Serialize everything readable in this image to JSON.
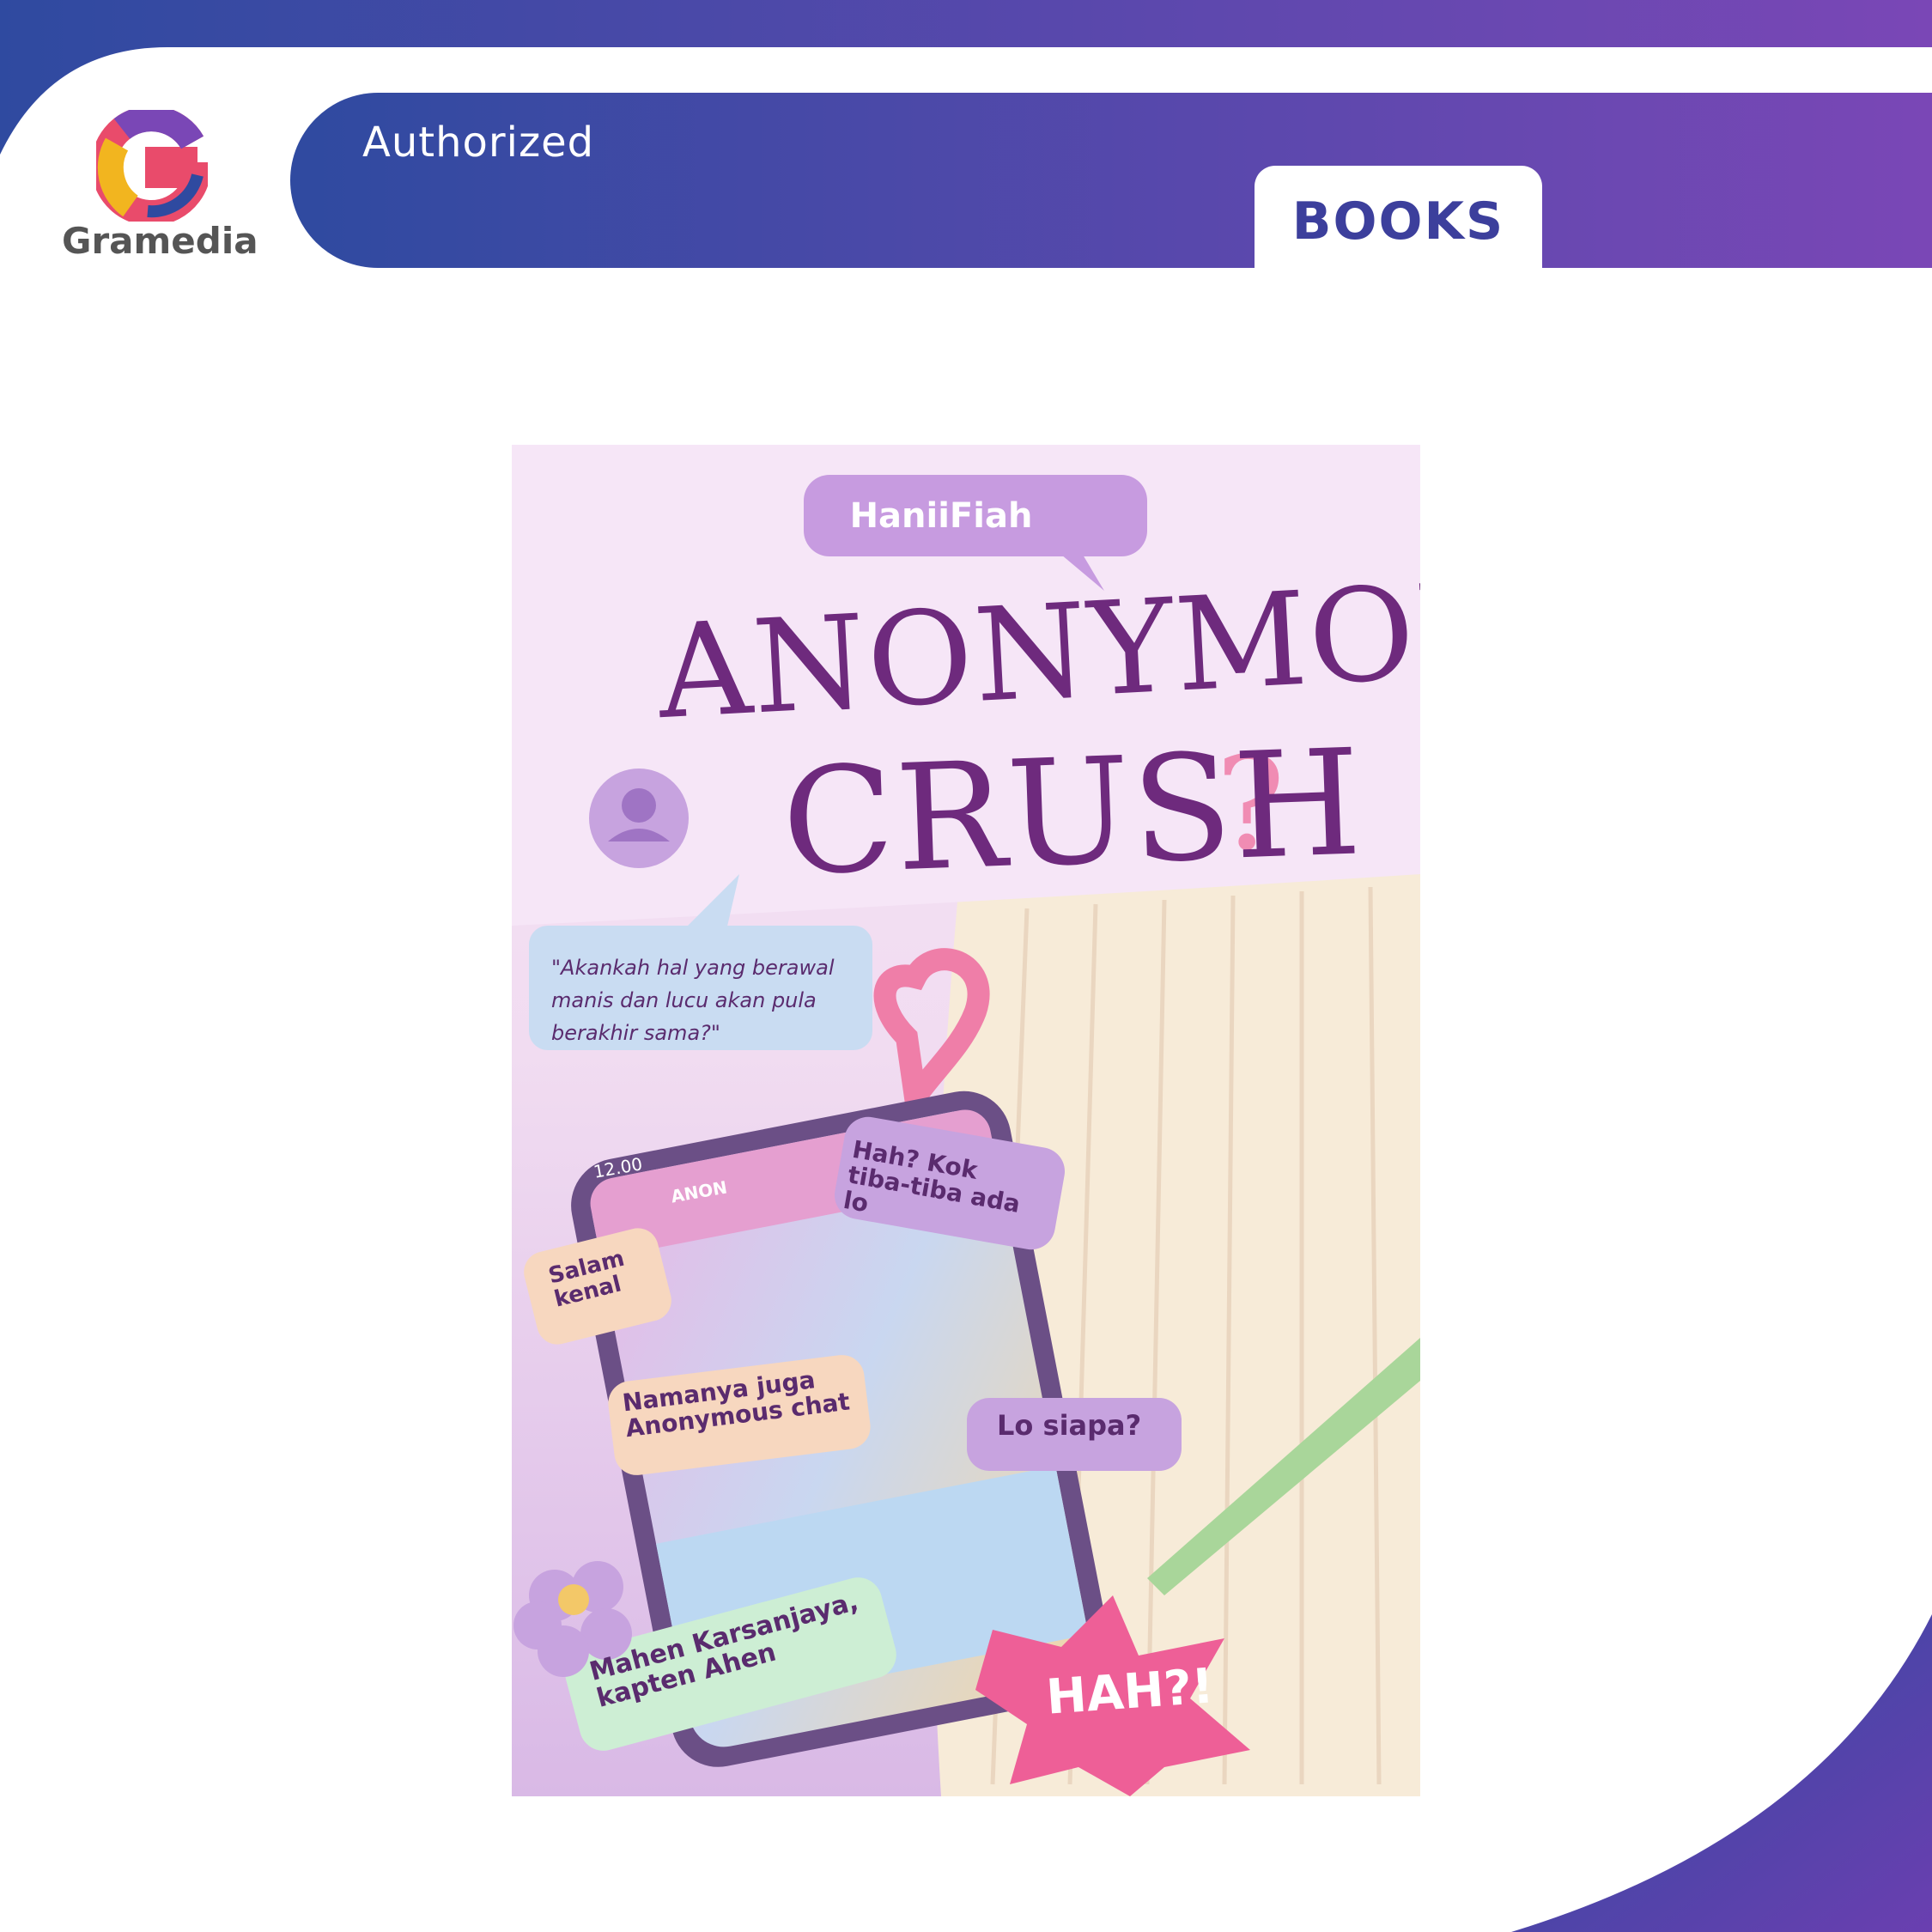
{
  "header": {
    "brand": "Gramedia",
    "tagline": "Authorized",
    "category": "BOOKS"
  },
  "cover": {
    "author": "HaniiFiah",
    "title_line1": "ANONYMOUS",
    "title_line2": "CRUSH",
    "quote": "\"Akankah hal yang berawal manis dan lucu akan pula berakhir sama?\"",
    "phone_time": "12.00",
    "phone_contact": "ANON",
    "bubbles": {
      "hah": "Hah? Kok tiba-tiba ada lo",
      "salam": "Salam kenal",
      "nama": "Namanya juga Anonymous chat",
      "lo": "Lo siapa?",
      "mahen": "Mahen Karsanjaya, kapten Ahen",
      "burst": "HAH?!"
    }
  },
  "colors": {
    "gradient_start": "#2f4aa0",
    "gradient_end": "#7a47b6",
    "books_text": "#3c3f9c",
    "title_purple": "#6e2a7d",
    "cover_pink": "#f1dcf1"
  }
}
